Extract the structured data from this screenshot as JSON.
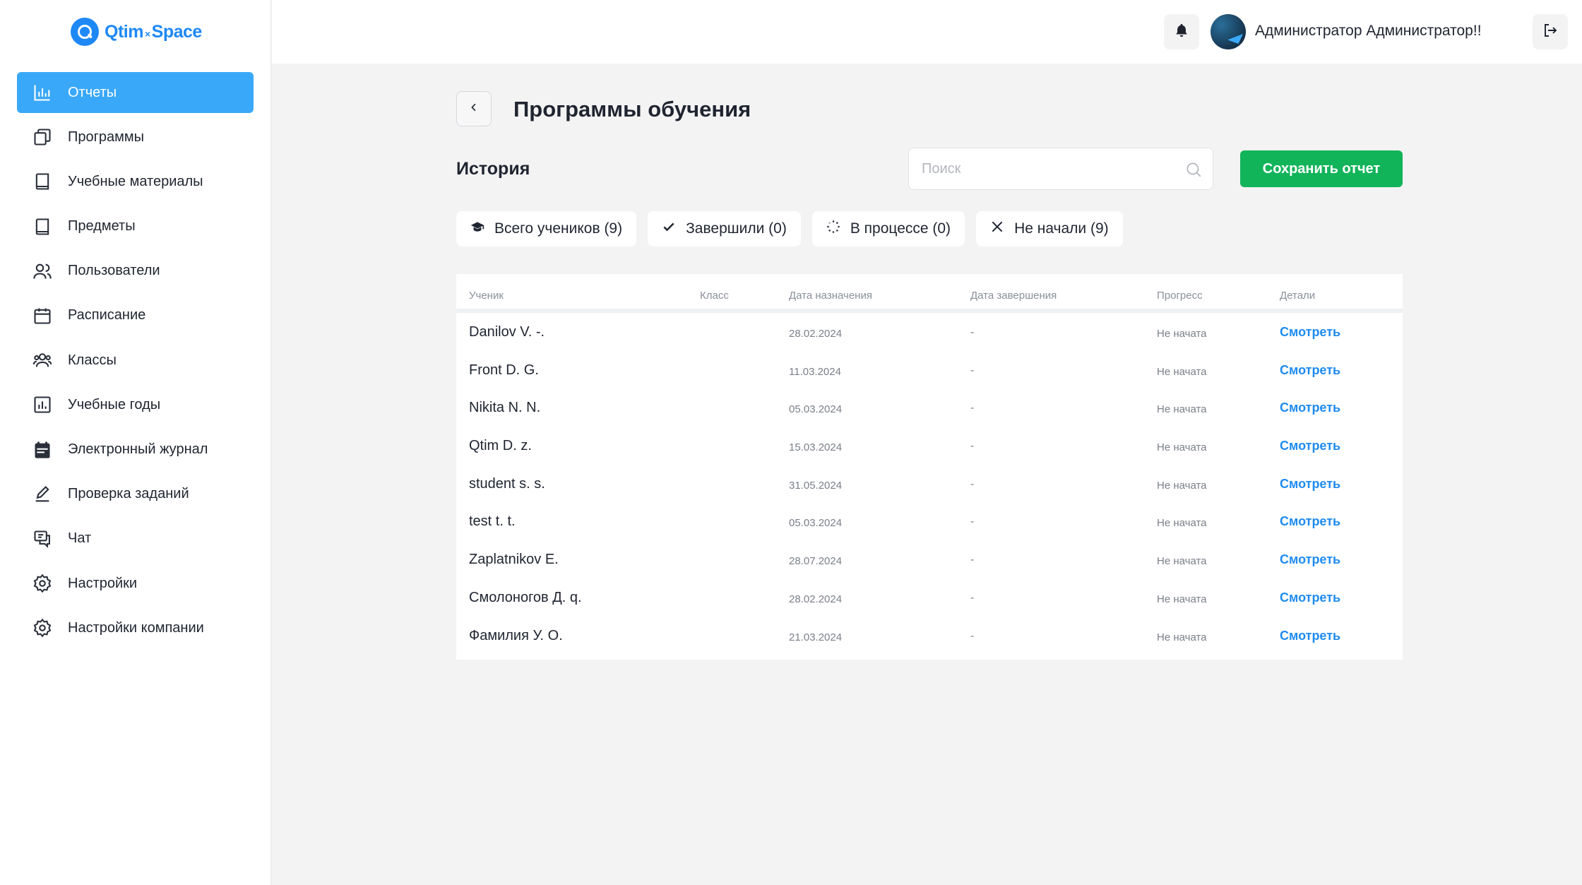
{
  "logo": {
    "part1": "Qtim",
    "sep": "×",
    "part2": "Space"
  },
  "sidebar": {
    "items": [
      {
        "label": "Отчеты",
        "icon": "bar-chart-icon",
        "active": true
      },
      {
        "label": "Программы",
        "icon": "copy-icon"
      },
      {
        "label": "Учебные материалы",
        "icon": "book-icon"
      },
      {
        "label": "Предметы",
        "icon": "book-icon"
      },
      {
        "label": "Пользователи",
        "icon": "users-icon"
      },
      {
        "label": "Расписание",
        "icon": "calendar-icon"
      },
      {
        "label": "Классы",
        "icon": "group-icon"
      },
      {
        "label": "Учебные годы",
        "icon": "chart-box-icon"
      },
      {
        "label": "Электронный журнал",
        "icon": "calendar-filled-icon"
      },
      {
        "label": "Проверка заданий",
        "icon": "pencil-icon"
      },
      {
        "label": "Чат",
        "icon": "chat-icon"
      },
      {
        "label": "Настройки",
        "icon": "gear-icon"
      },
      {
        "label": "Настройки компании",
        "icon": "gear-icon"
      }
    ]
  },
  "header": {
    "user_name": "Администратор Администратор!!"
  },
  "main": {
    "title": "Программы обучения",
    "section": "История",
    "search_placeholder": "Поиск",
    "save_label": "Сохранить отчет",
    "filters": [
      {
        "label": "Всего учеников (9)",
        "icon": "graduation-cap-icon"
      },
      {
        "label": "Завершили (0)",
        "icon": "check-icon"
      },
      {
        "label": "В процессе (0)",
        "icon": "loading-icon"
      },
      {
        "label": "Не начали (9)",
        "icon": "close-icon"
      }
    ],
    "table": {
      "columns": [
        "Ученик",
        "Класс",
        "Дата назначения",
        "Дата завершения",
        "Прогресс",
        "Детали"
      ],
      "rows": [
        {
          "student": "Danilov V. -.",
          "class": "",
          "assigned": "28.02.2024",
          "completed": "-",
          "progress": "Не начата",
          "details": "Смотреть"
        },
        {
          "student": "Front D. G.",
          "class": "",
          "assigned": "11.03.2024",
          "completed": "-",
          "progress": "Не начата",
          "details": "Смотреть"
        },
        {
          "student": "Nikita N. N.",
          "class": "",
          "assigned": "05.03.2024",
          "completed": "-",
          "progress": "Не начата",
          "details": "Смотреть"
        },
        {
          "student": "Qtim D. z.",
          "class": "",
          "assigned": "15.03.2024",
          "completed": "-",
          "progress": "Не начата",
          "details": "Смотреть"
        },
        {
          "student": "student s. s.",
          "class": "",
          "assigned": "31.05.2024",
          "completed": "-",
          "progress": "Не начата",
          "details": "Смотреть"
        },
        {
          "student": "test t. t.",
          "class": "",
          "assigned": "05.03.2024",
          "completed": "-",
          "progress": "Не начата",
          "details": "Смотреть"
        },
        {
          "student": "Zaplatnikov E.",
          "class": "",
          "assigned": "28.07.2024",
          "completed": "-",
          "progress": "Не начата",
          "details": "Смотреть"
        },
        {
          "student": "Смолоногов Д. q.",
          "class": "",
          "assigned": "28.02.2024",
          "completed": "-",
          "progress": "Не начата",
          "details": "Смотреть"
        },
        {
          "student": "Фамилия У. О.",
          "class": "",
          "assigned": "21.03.2024",
          "completed": "-",
          "progress": "Не начата",
          "details": "Смотреть"
        }
      ]
    }
  },
  "colors": {
    "accent": "#3aa8f8",
    "brand": "#1e88f5",
    "save": "#12b45a",
    "link": "#1e8bf0"
  }
}
